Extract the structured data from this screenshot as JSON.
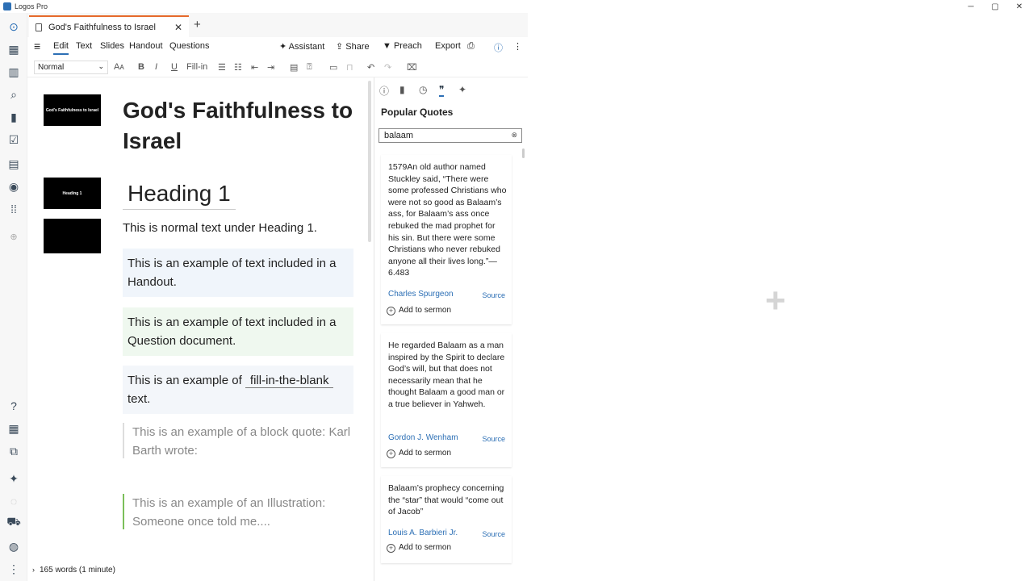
{
  "window": {
    "title": "Logos Pro",
    "minimize": "─",
    "maximize": "▢",
    "close": "✕"
  },
  "tab": {
    "label": "God's Faithfulness to Israel",
    "close": "✕",
    "new": "+"
  },
  "menu": {
    "hamburger": "≡",
    "edit": "Edit",
    "text": "Text",
    "slides": "Slides",
    "handout": "Handout",
    "questions": "Questions",
    "assistant": "Assistant",
    "share": "Share",
    "preach": "Preach",
    "export": "Export"
  },
  "toolbar": {
    "style": "Normal",
    "fontsize": "Aᴀ",
    "bold": "B",
    "italic": "I",
    "underline": "U",
    "fillin": "Fill-in"
  },
  "thumbnails": [
    {
      "label": "God's Faithfulness to Israel"
    },
    {
      "label": "Heading 1"
    },
    {
      "label": ""
    }
  ],
  "document": {
    "title": "God's Faithfulness to Israel",
    "heading1": "Heading 1",
    "normal": "This is normal  text under Heading 1.",
    "handout": "This is an example of text included in a Handout.",
    "question": "This is an example of text included in a Question document.",
    "fill_pre": "This is an example of ",
    "fill_blank": "fill-in-the-blank",
    "fill_post": "text.",
    "blockquote": "This is an example of a block quote: Karl Barth wrote:",
    "illustration": "This is an example of an Illustration: Someone once told me...."
  },
  "status": {
    "words": "165 words (1 minute)"
  },
  "panel": {
    "title": "Popular Quotes",
    "search_value": "balaam",
    "quotes": [
      {
        "text": "1579An old author named Stuckley said, “There were some professed Christians who were not so good as Balaam’s ass, for Balaam’s ass once rebuked the mad prophet for his sin. But there were some Christians who never rebuked anyone all their lives long.”—6.483",
        "author": "Charles Spurgeon",
        "source": "Source",
        "add": "Add to sermon"
      },
      {
        "text": "He regarded Balaam as a man inspired by the Spirit to declare God’s will, but that does not necessarily mean that he thought Balaam a good man or a true believer in Yahweh.",
        "author": "Gordon J. Wenham",
        "source": "Source",
        "add": "Add to sermon"
      },
      {
        "text": "Balaam’s prophecy concerning the “star” that would “come out of Jacob”",
        "author": "Louis A. Barbieri Jr.",
        "source": "Source",
        "add": "Add to sermon"
      }
    ]
  }
}
